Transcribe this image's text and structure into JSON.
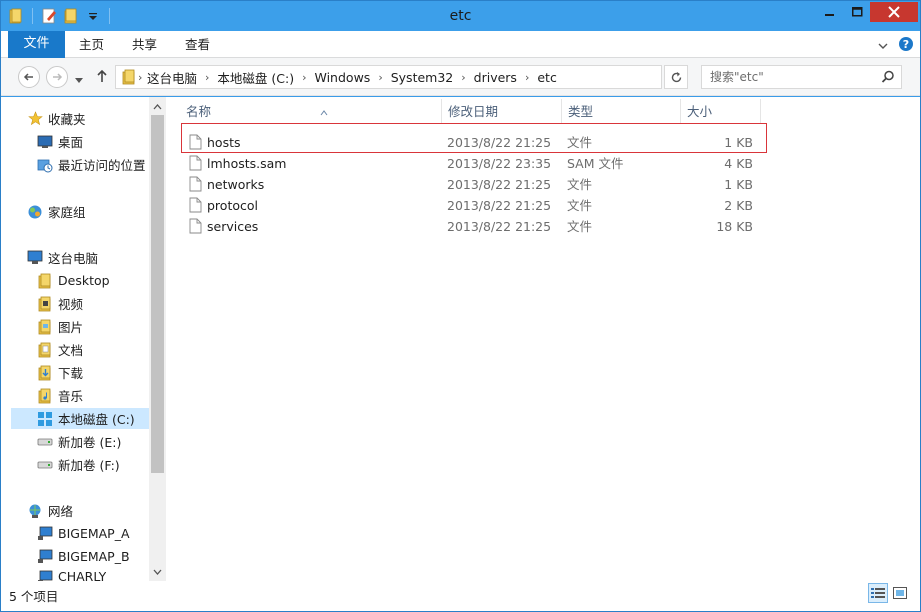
{
  "window": {
    "title": "etc"
  },
  "ribbon": {
    "tabs": [
      "文件",
      "主页",
      "共享",
      "查看"
    ]
  },
  "address": {
    "crumbs": [
      "这台电脑",
      "本地磁盘 (C:)",
      "Windows",
      "System32",
      "drivers",
      "etc"
    ],
    "search_placeholder": "搜索\"etc\""
  },
  "nav": {
    "items": [
      {
        "label": "收藏夹",
        "icon": "star-icon"
      },
      {
        "label": "桌面",
        "icon": "desktop-icon"
      },
      {
        "label": "最近访问的位置",
        "icon": "recent-places-icon"
      },
      {
        "label": "家庭组",
        "icon": "homegroup-icon"
      },
      {
        "label": "这台电脑",
        "icon": "computer-icon"
      },
      {
        "label": "Desktop",
        "icon": "folder-icon"
      },
      {
        "label": "视频",
        "icon": "videos-folder-icon"
      },
      {
        "label": "图片",
        "icon": "pictures-folder-icon"
      },
      {
        "label": "文档",
        "icon": "documents-folder-icon"
      },
      {
        "label": "下载",
        "icon": "downloads-folder-icon"
      },
      {
        "label": "音乐",
        "icon": "music-folder-icon"
      },
      {
        "label": "本地磁盘 (C:)",
        "icon": "system-drive-icon"
      },
      {
        "label": "新加卷 (E:)",
        "icon": "drive-icon"
      },
      {
        "label": "新加卷 (F:)",
        "icon": "drive-icon"
      },
      {
        "label": "网络",
        "icon": "network-icon"
      },
      {
        "label": "BIGEMAP_A",
        "icon": "network-computer-icon"
      },
      {
        "label": "BIGEMAP_B",
        "icon": "network-computer-icon"
      },
      {
        "label": "CHARLY",
        "icon": "network-computer-icon"
      }
    ]
  },
  "files": {
    "headers": {
      "name": "名称",
      "date": "修改日期",
      "type": "类型",
      "size": "大小"
    },
    "rows": [
      {
        "name": "hosts",
        "date": "2013/8/22 21:25",
        "type": "文件",
        "size": "1 KB"
      },
      {
        "name": "lmhosts.sam",
        "date": "2013/8/22 23:35",
        "type": "SAM 文件",
        "size": "4 KB"
      },
      {
        "name": "networks",
        "date": "2013/8/22 21:25",
        "type": "文件",
        "size": "1 KB"
      },
      {
        "name": "protocol",
        "date": "2013/8/22 21:25",
        "type": "文件",
        "size": "2 KB"
      },
      {
        "name": "services",
        "date": "2013/8/22 21:25",
        "type": "文件",
        "size": "18 KB"
      }
    ]
  },
  "status": {
    "text": "5 个项目"
  },
  "colors": {
    "titlebar": "#3c9fea",
    "file_tab": "#1979ca",
    "close": "#c7372f",
    "highlight": "#d9353a",
    "selected": "#cce8ff"
  }
}
